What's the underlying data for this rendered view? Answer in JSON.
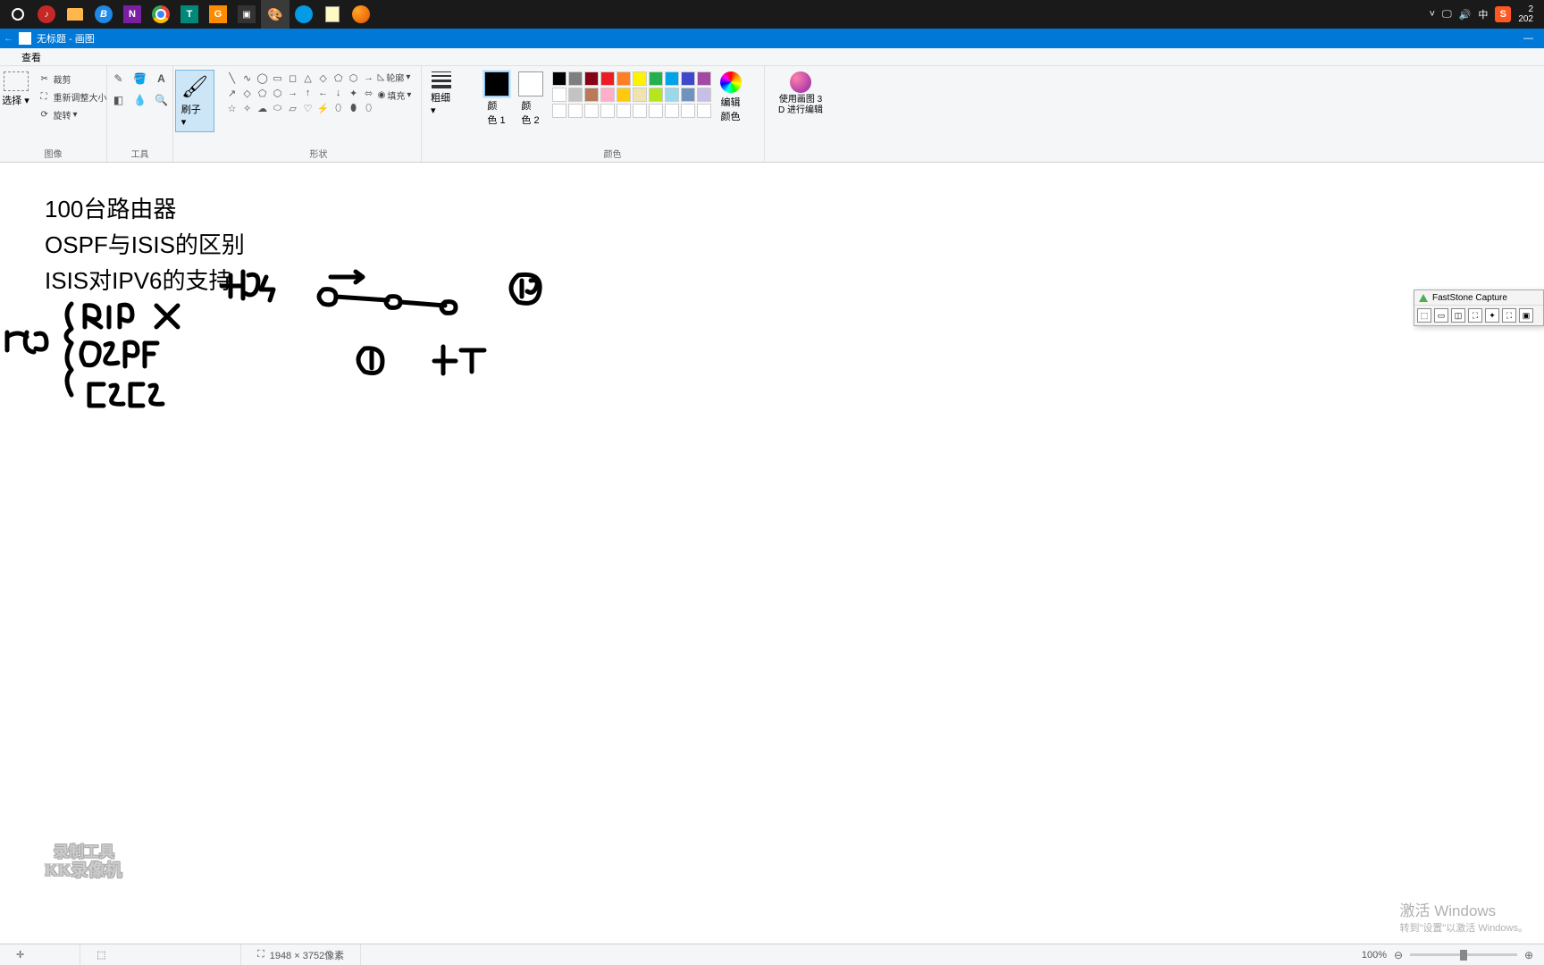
{
  "taskbar": {
    "time1": "2",
    "time2": "202",
    "ime": "中",
    "sogou": "S"
  },
  "titlebar": {
    "text": "无标题 - 画图"
  },
  "menubar": {
    "view": "查看"
  },
  "ribbon": {
    "clipboard": {
      "select": "选择",
      "cut": "裁剪",
      "resize": "重新调整大小",
      "rotate": "旋转",
      "group": "图像"
    },
    "tools": {
      "group": "工具"
    },
    "brush": {
      "label": "刷子",
      "dd": "▾"
    },
    "shapes": {
      "outline": "轮廓",
      "fill": "填充",
      "group": "形状"
    },
    "size": {
      "label": "粗细",
      "dd": "▾"
    },
    "colors": {
      "c1a": "颜",
      "c1b": "色 1",
      "c2a": "颜",
      "c2b": "色 2",
      "edit1": "编辑",
      "edit2": "颜色",
      "group": "颜色"
    },
    "paint3d": {
      "l1": "使用画图 3",
      "l2": "D 进行编辑"
    }
  },
  "canvas": {
    "t1": "100台路由器",
    "t2": "OSPF与ISIS的区别",
    "t3": "ISIS对IPV6的支持"
  },
  "watermark": {
    "l1": "录制工具",
    "l2": "KK录像机"
  },
  "activate": {
    "l1": "激活 Windows",
    "l2": "转到\"设置\"以激活 Windows。"
  },
  "faststone": {
    "title": "FastStone Capture"
  },
  "status": {
    "dims": "1948 × 3752像素",
    "zoom": "100%"
  },
  "palette": [
    "#000000",
    "#7f7f7f",
    "#880015",
    "#ed1c24",
    "#ff7f27",
    "#fff200",
    "#22b14c",
    "#00a2e8",
    "#3f48cc",
    "#a349a4",
    "#ffffff",
    "#c3c3c3",
    "#b97a57",
    "#ffaec9",
    "#ffc90e",
    "#efe4b0",
    "#b5e61d",
    "#99d9ea",
    "#7092be",
    "#c8bfe7",
    "#ffffff",
    "#ffffff",
    "#ffffff",
    "#ffffff",
    "#ffffff",
    "#ffffff",
    "#ffffff",
    "#ffffff",
    "#ffffff",
    "#ffffff"
  ]
}
